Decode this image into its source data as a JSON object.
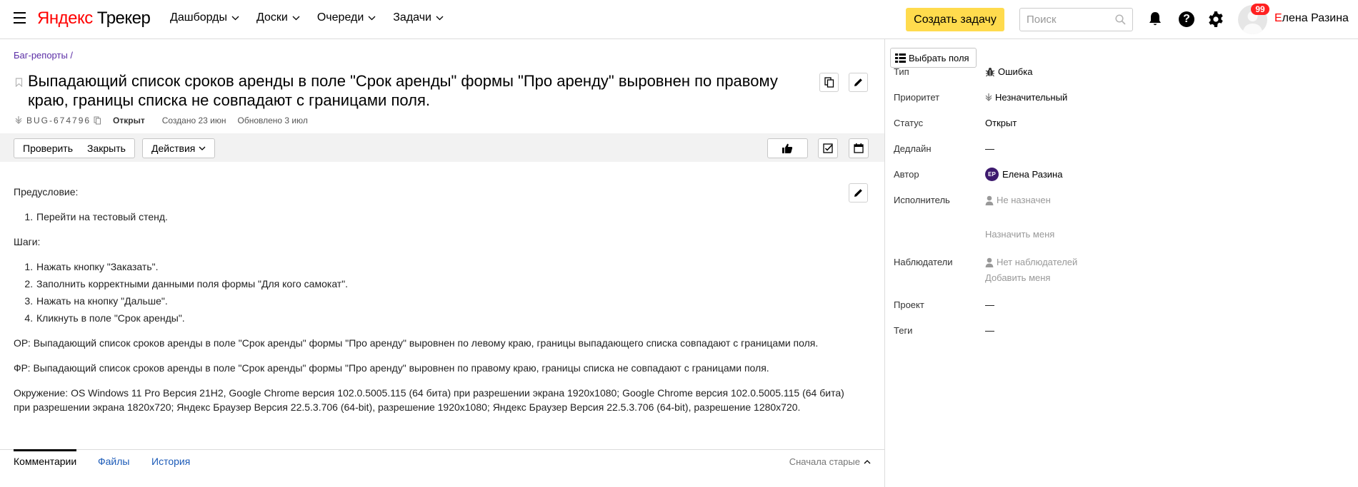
{
  "header": {
    "logo_yandex": "Яндекс",
    "logo_product": "Трекер",
    "nav": [
      {
        "label": "Дашборды"
      },
      {
        "label": "Доски"
      },
      {
        "label": "Очереди"
      },
      {
        "label": "Задачи"
      }
    ],
    "create_button": "Создать задачу",
    "search_placeholder": "Поиск",
    "notification_count": "99",
    "user_first_letter": "Е",
    "user_name_rest": "лена Разина"
  },
  "issue": {
    "breadcrumb": "Баг-репорты /",
    "title": "Выпадающий список сроков аренды в поле \"Срок аренды\" формы \"Про аренду\" выровнен по правому краю, границы списка не совпадают с границами поля.",
    "key": "BUG-674796",
    "status": "Открыт",
    "created": "Создано 23 июн",
    "updated": "Обновлено 3 июл"
  },
  "toolbar": {
    "check_button": "Проверить",
    "close_button": "Закрыть",
    "actions_button": "Действия"
  },
  "description": {
    "precondition_label": "Предусловие:",
    "precondition_items": [
      "Перейти на тестовый стенд."
    ],
    "steps_label": "Шаги:",
    "steps": [
      "Нажать кнопку \"Заказать\".",
      "Заполнить корректными данными поля формы \"Для кого самокат\".",
      "Нажать на кнопку \"Дальше\".",
      "Кликнуть в поле \"Срок аренды\"."
    ],
    "expected": "ОР: Выпадающий список сроков аренды в поле \"Срок аренды\" формы \"Про аренду\" выровнен по левому краю, границы выпадающего списка совпадают с границами поля.",
    "actual": "ФР: Выпадающий список сроков аренды в поле \"Срок аренды\" формы \"Про аренду\" выровнен по правому краю, границы списка не совпадают с границами поля.",
    "environment_line1": "Окружение: OS Windows 11 Pro Версия 21H2, Google Chrome версия 102.0.5005.115 (64 бита) при разрешении экрана 1920x1080; Google Chrome версия 102.0.5005.115 (64 бита)",
    "environment_line2": "при разрешении экрана 1820x720; Яндекс Браузер Версия 22.5.3.706 (64-bit), разрешение 1920x1080; Яндекс Браузер Версия 22.5.3.706 (64-bit), разрешение 1280x720."
  },
  "tabs": {
    "comments": "Комментарии",
    "files": "Файлы",
    "history": "История",
    "sort": "Сначала старые"
  },
  "sidebar": {
    "choose_fields": "Выбрать поля",
    "type_label": "Тип",
    "type_value": "Ошибка",
    "priority_label": "Приоритет",
    "priority_value": "Незначительный",
    "status_label": "Статус",
    "status_value": "Открыт",
    "deadline_label": "Дедлайн",
    "deadline_value": "—",
    "author_label": "Автор",
    "author_initials": "ЕР",
    "author_value": "Елена Разина",
    "assignee_label": "Исполнитель",
    "assignee_value": "Не назначен",
    "assign_me": "Назначить меня",
    "watchers_label": "Наблюдатели",
    "watchers_value": "Нет наблюдателей",
    "add_me": "Добавить меня",
    "project_label": "Проект",
    "project_value": "—",
    "tags_label": "Теги",
    "tags_value": "—"
  },
  "colors": {
    "accent_yellow": "#ffdb4d",
    "badge_red": "#ff2121",
    "link_blue": "#1c5bb8",
    "breadcrumb_purple": "#5b2ea6"
  }
}
